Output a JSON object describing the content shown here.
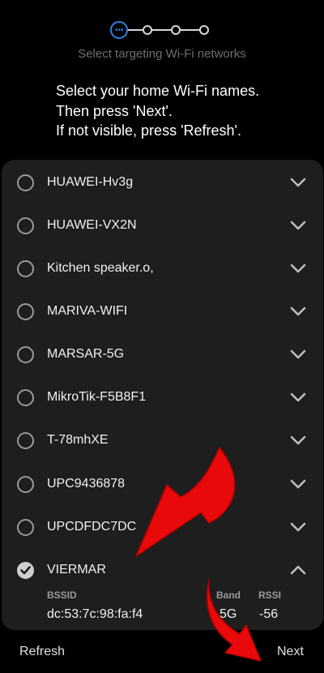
{
  "colors": {
    "accent": "#2f7fe0",
    "arrow": "#e8090b",
    "panel": "#1e1e1e"
  },
  "stepper": {
    "steps": 4,
    "current": 1
  },
  "step_caption": "Select targeting Wi-Fi networks",
  "instructions": {
    "line1": "Select your home Wi-Fi names.",
    "line2": "Then press 'Next'.",
    "line3": "If not visible, press 'Refresh'."
  },
  "networks": [
    {
      "name": "HUAWEI-Hv3g",
      "checked": false,
      "expanded": false
    },
    {
      "name": "HUAWEI-VX2N",
      "checked": false,
      "expanded": false
    },
    {
      "name": "Kitchen speaker.o,",
      "checked": false,
      "expanded": false
    },
    {
      "name": "MARIVA-WIFI",
      "checked": false,
      "expanded": false
    },
    {
      "name": "MARSAR-5G",
      "checked": false,
      "expanded": false
    },
    {
      "name": "MikroTik-F5B8F1",
      "checked": false,
      "expanded": false
    },
    {
      "name": "T-78mhXE",
      "checked": false,
      "expanded": false
    },
    {
      "name": "UPC9436878",
      "checked": false,
      "expanded": false
    },
    {
      "name": "UPCDFDC7DC",
      "checked": false,
      "expanded": false
    },
    {
      "name": "VIERMAR",
      "checked": true,
      "expanded": true
    }
  ],
  "details": {
    "bssid_label": "BSSID",
    "band_label": "Band",
    "rssi_label": "RSSI",
    "bssid": "dc:53:7c:98:fa:f4",
    "band": "5G",
    "rssi": "-56"
  },
  "buttons": {
    "refresh": "Refresh",
    "next": "Next"
  },
  "icons": {
    "chevron": "chevron-down-icon",
    "chevron_up": "chevron-up-icon",
    "check": "checkmark-icon",
    "arrow": "red-arrow-annotation"
  }
}
